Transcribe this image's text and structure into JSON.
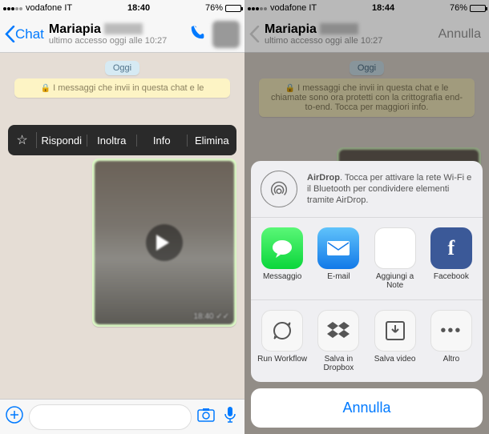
{
  "left": {
    "status": {
      "carrier": "vodafone IT",
      "time": "18:40",
      "batt": "76%"
    },
    "header": {
      "back": "Chat",
      "name": "Mariapia",
      "sub": "ultimo accesso oggi alle 10:27"
    },
    "chat": {
      "day": "Oggi",
      "encrypt": "I messaggi che invii in questa chat e le",
      "menu": {
        "reply": "Rispondi",
        "forward": "Inoltra",
        "info": "Info",
        "delete": "Elimina"
      },
      "video_time": "18:40 ✓✓"
    }
  },
  "right": {
    "status": {
      "carrier": "vodafone IT",
      "time": "18:44",
      "batt": "76%"
    },
    "header": {
      "back": "",
      "name": "Mariapia",
      "sub": "ultimo accesso oggi alle 10:27",
      "cancel": "Annulla"
    },
    "chat": {
      "day": "Oggi",
      "encrypt": "I messaggi che invii in questa chat e le chiamate sono ora protetti con la crittografia end-to-end. Tocca per maggiori info."
    },
    "airdrop": {
      "title": "AirDrop",
      "text": ". Tocca per attivare la rete Wi-Fi e il Bluetooth per condividere elementi tramite AirDrop."
    },
    "apps1": {
      "msg": "Messaggio",
      "mail": "E-mail",
      "note": "Aggiungi a Note",
      "fb": "Facebook"
    },
    "apps2": {
      "wf": "Run Workflow",
      "db": "Salva in Dropbox",
      "sv": "Salva video",
      "more": "Altro"
    },
    "cancel": "Annulla"
  }
}
